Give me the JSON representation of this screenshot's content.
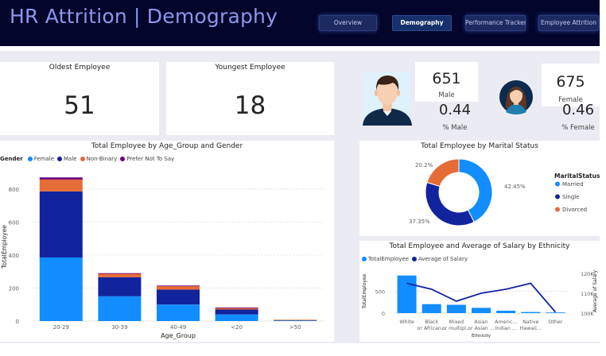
{
  "header": {
    "title": "HR Attrition | Demography",
    "nav": [
      {
        "label": "Overview",
        "active": false
      },
      {
        "label": "Demography",
        "active": true
      },
      {
        "label": "Performance Tracker",
        "active": false
      },
      {
        "label": "Employee Attrition",
        "active": false
      }
    ]
  },
  "kpis": {
    "oldest": {
      "title": "Oldest Employee",
      "value": "51"
    },
    "youngest": {
      "title": "Youngest Employee",
      "value": "18"
    }
  },
  "gender": {
    "male": {
      "count": "651",
      "label": "Male",
      "pct": "0.44",
      "pct_label": "% Male",
      "icon": "male-avatar-icon"
    },
    "female": {
      "count": "675",
      "label": "Female",
      "pct": "0.46",
      "pct_label": "% Female",
      "icon": "female-avatar-icon"
    }
  },
  "colors": {
    "female": "#118dff",
    "male": "#12239e",
    "non_binary": "#e66c37",
    "prefer_not": "#6b007b"
  },
  "chart_data": [
    {
      "type": "bar",
      "stacked": true,
      "title": "Total Employee by Age_Group and Gender",
      "legend_title": "Gender",
      "xlabel": "Age_Group",
      "ylabel": "TotalEmployee",
      "categories": [
        "20-29",
        "30-39",
        "40-49",
        "<20",
        ">50"
      ],
      "series": [
        {
          "name": "Female",
          "values": [
            385,
            150,
            100,
            40,
            4
          ]
        },
        {
          "name": "Male",
          "values": [
            400,
            115,
            90,
            30,
            3
          ]
        },
        {
          "name": "Non-Binary",
          "values": [
            72,
            22,
            22,
            9,
            1
          ]
        },
        {
          "name": "Prefer Not To Say",
          "values": [
            13,
            3,
            3,
            3,
            0
          ]
        }
      ],
      "ylim": [
        0,
        900
      ],
      "yticks": [
        0,
        200,
        400,
        600,
        800
      ],
      "grid": true,
      "legend": "top-left"
    },
    {
      "type": "pie",
      "donut": true,
      "title": "Total Employee by Marital Status",
      "legend_title": "MaritalStatus",
      "slices": [
        {
          "name": "Married",
          "value": 42.45,
          "label": "42.45%"
        },
        {
          "name": "Single",
          "value": 37.35,
          "label": "37.35%"
        },
        {
          "name": "Divorced",
          "value": 20.2,
          "label": "20.2%"
        }
      ],
      "legend": "right"
    },
    {
      "type": "bar",
      "combo_line": true,
      "title": "Total Employee and Average of Salary by Ethnicity",
      "xlabel": "Ethnicity",
      "ylabel": "TotalEmployee",
      "ylabel_right": "Average of Salary",
      "categories": [
        "White",
        "Black or African...",
        "Mixed or multipl...",
        "Asian or Asian ...",
        "Americ... Indian ...",
        "Native Hawaii...",
        "Other"
      ],
      "series": [
        {
          "name": "TotalEmployee",
          "values": [
            860,
            205,
            190,
            120,
            55,
            25,
            15
          ]
        },
        {
          "name": "Average of Salary",
          "values": [
            115000,
            112000,
            106000,
            110000,
            112000,
            115000,
            100500
          ]
        }
      ],
      "ylim": [
        0,
        1000
      ],
      "yticks": [
        0,
        500
      ],
      "ylim_right": [
        100000,
        122000
      ],
      "yticks_right": [
        "100K",
        "110K",
        "120K"
      ],
      "legend": "top-left"
    }
  ]
}
